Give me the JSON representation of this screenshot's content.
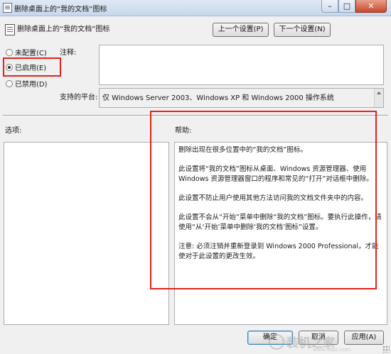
{
  "window": {
    "title": "删除桌面上的“我的文档”图标",
    "minimize_glyph": "–",
    "maximize_glyph": "□",
    "close_glyph": "✕",
    "icon": "policy-document-icon"
  },
  "header": {
    "policy_title": "删除桌面上的“我的文档”图标",
    "prev_setting": "上一个设置(P)",
    "next_setting": "下一个设置(N)"
  },
  "state": {
    "options": [
      {
        "label": "未配置(C)",
        "checked": false
      },
      {
        "label": "已启用(E)",
        "checked": true
      },
      {
        "label": "已禁用(D)",
        "checked": false
      }
    ]
  },
  "fields": {
    "comment_label": "注释:",
    "comment_value": "",
    "platform_label": "支持的平台:",
    "platform_value": "仅 Windows Server 2003、Windows XP 和 Windows 2000 操作系统"
  },
  "panels": {
    "options_label": "选项:",
    "help_label": "帮助:",
    "help_paragraphs": [
      "删除出现在很多位置中的“我的文档”图标。",
      "此设置将“我的文档”图标从桌面、Windows 资源管理器、使用 Windows 资源管理器窗口的程序和常见的“打开”对话框中删除。",
      "此设置不防止用户使用其他方法访问我的文档文件夹中的内容。",
      "此设置不会从“开始”菜单中删除“我的文档”图标。要执行此操作，请使用“从‘开始’菜单中删除‘我的文档’图标”设置。",
      "注意: 必须注销并重新登录到 Windows 2000 Professional，才能使对于此设置的更改生效。"
    ]
  },
  "footer": {
    "ok": "确定",
    "cancel": "取消",
    "apply": "应用(A)"
  },
  "watermark": {
    "text": "装机之家",
    "url": "www.lotpc.com"
  },
  "colors": {
    "highlight": "#e2231a",
    "titlebar": "#c7d7ea",
    "panel_bg": "#f0f0f0"
  }
}
